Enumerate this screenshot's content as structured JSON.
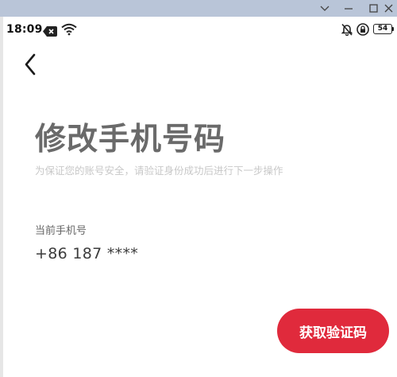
{
  "window_controls": {
    "icons": [
      "chevron-down-icon",
      "minimize-icon",
      "maximize-icon",
      "close-icon"
    ]
  },
  "status_bar": {
    "time": "18:09",
    "battery": "54",
    "left_icons": [
      "notification-x-icon",
      "wifi-icon"
    ],
    "right_icons": [
      "bell-off-icon",
      "lock-icon",
      "battery-icon"
    ]
  },
  "header": {
    "back_icon": "back-arrow-icon"
  },
  "page": {
    "title": "修改手机号码",
    "subtitle": "为保证您的账号安全，请验证身份成功后进行下一步操作",
    "phone_label": "当前手机号",
    "phone_value": "+86 187 ****"
  },
  "actions": {
    "get_code_label": "获取验证码"
  },
  "colors": {
    "accent": "#e02a3c",
    "title": "#6a6a6a",
    "subtitle": "#c8c8c8",
    "window_strip": "#b9c5d8"
  }
}
